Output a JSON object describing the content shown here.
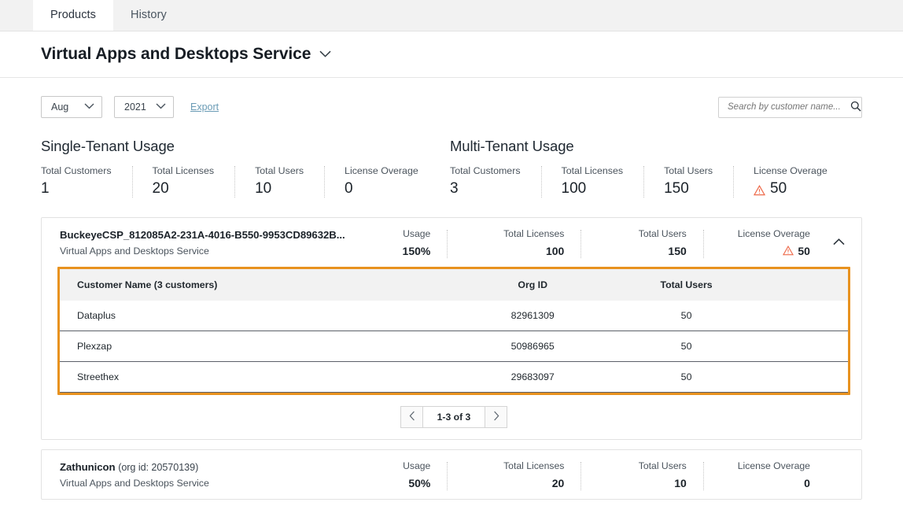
{
  "tabs": [
    {
      "label": "Products",
      "active": true
    },
    {
      "label": "History",
      "active": false
    }
  ],
  "page": {
    "title": "Virtual Apps and Desktops Service",
    "title_caret": "chevron-down"
  },
  "toolbar": {
    "month": "Aug",
    "year": "2021",
    "export_label": "Export"
  },
  "search": {
    "placeholder": "Search by customer name...",
    "value": "",
    "icon": "search-icon"
  },
  "summaries": [
    {
      "title": "Single-Tenant Usage",
      "stats": [
        {
          "label": "Total Customers",
          "value": "1",
          "warn": false
        },
        {
          "label": "Total Licenses",
          "value": "20",
          "warn": false
        },
        {
          "label": "Total Users",
          "value": "10",
          "warn": false
        },
        {
          "label": "License Overage",
          "value": "0",
          "warn": false
        }
      ]
    },
    {
      "title": "Multi-Tenant Usage",
      "stats": [
        {
          "label": "Total Customers",
          "value": "3",
          "warn": false
        },
        {
          "label": "Total Licenses",
          "value": "100",
          "warn": false
        },
        {
          "label": "Total Users",
          "value": "150",
          "warn": false
        },
        {
          "label": "License Overage",
          "value": "50",
          "warn": true
        }
      ]
    }
  ],
  "cards": [
    {
      "name": "BuckeyeCSP_812085A2-231A-4016-B550-9953CD89632B...",
      "org_id_suffix": "",
      "subtitle": "Virtual Apps and Desktops Service",
      "usage_label": "Usage",
      "usage_value": "150%",
      "licenses_label": "Total Licenses",
      "licenses_value": "100",
      "users_label": "Total Users",
      "users_value": "150",
      "overage_label": "License Overage",
      "overage_value": "50",
      "overage_warn": true,
      "chevron": "chevron-up",
      "expanded": true,
      "table": {
        "highlighted": true,
        "highlight_color": "#e8921f",
        "columns": [
          "Customer Name (3 customers)",
          "Org ID",
          "Total Users"
        ],
        "rows": [
          {
            "name": "Dataplus",
            "org_id": "82961309",
            "total_users": "50"
          },
          {
            "name": "Plexzap",
            "org_id": "50986965",
            "total_users": "50"
          },
          {
            "name": "Streethex",
            "org_id": "29683097",
            "total_users": "50"
          }
        ],
        "pagination": {
          "prev_icon": "chevron-left-icon",
          "range": "1-3 of 3",
          "next_icon": "chevron-right-icon"
        }
      }
    },
    {
      "name": "Zathunicon",
      "org_id_suffix": "(org id: 20570139)",
      "subtitle": "Virtual Apps and Desktops Service",
      "usage_label": "Usage",
      "usage_value": "50%",
      "licenses_label": "Total Licenses",
      "licenses_value": "20",
      "users_label": "Total Users",
      "users_value": "10",
      "overage_label": "License Overage",
      "overage_value": "0",
      "overage_warn": false,
      "chevron": "",
      "expanded": false
    }
  ],
  "colors": {
    "highlight": "#e8921f",
    "warning": "#ee6c4d",
    "link": "#6a9bb5"
  }
}
